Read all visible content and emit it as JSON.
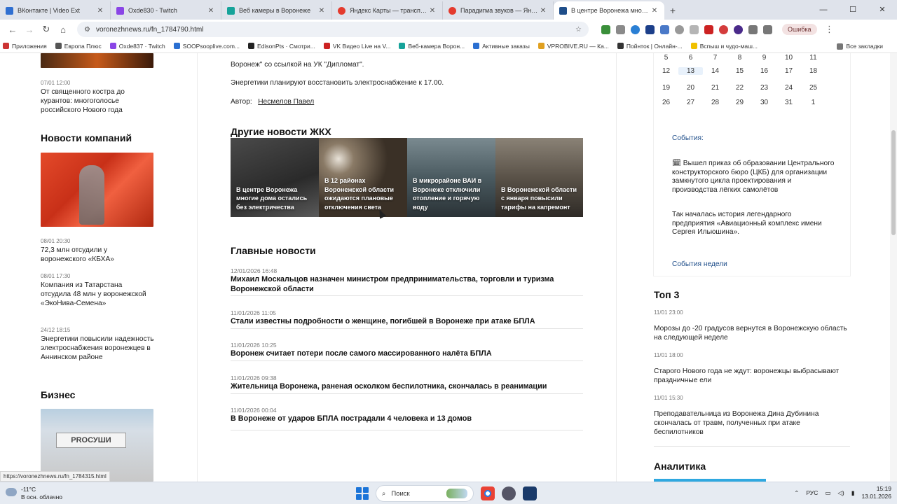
{
  "browser": {
    "tabs": [
      {
        "title": "ВКонтакте | Video Ext",
        "fav": "#2f6fd1"
      },
      {
        "title": "Oxde830 - Twitch",
        "fav": "#8a45e6"
      },
      {
        "title": "Веб камеры в Воронеже",
        "fav": "#16a39a"
      },
      {
        "title": "Яндекс Карты — транспорт, н",
        "fav": "#e43b2e"
      },
      {
        "title": "Парадигма звуков — Яндекс М",
        "fav": "#e43b2e"
      },
      {
        "title": "В центре Воронежа многие д",
        "fav": "#1f4e8a"
      }
    ],
    "new_tab": "+",
    "url": "voronezhnews.ru/fn_1784790.html",
    "error_label": "Ошибка",
    "bookmarks": [
      "Приложения",
      "Европа Плюс",
      "Oxde837 · Twitch",
      "SOOPsooplive.com...",
      "EdisonPts · Смотри...",
      "VK Видео Live на V...",
      "Веб-камера Ворон...",
      "Активные заказы",
      "VPROBIVE.RU — Ка...",
      "Пойнток | Онлайн-...",
      "Вспыш и чудо-маш..."
    ],
    "all_bookmarks": "Все закладки"
  },
  "left": {
    "item1": {
      "date": "07/01 12:00",
      "title": "От священного костра до курантов: многоголосье российского Нового года"
    },
    "companies_heading": "Новости компаний",
    "items": [
      {
        "date": "08/01 20:30",
        "title": "72,3 млн отсудили у воронежского «КБХА»"
      },
      {
        "date": "08/01 17:30",
        "title": "Компания из Татарстана отсудила 48 млн у воронежской «ЭкоНива-Семена»"
      },
      {
        "date": "24/12 18:15",
        "title": "Энергетики повысили надежность электроснабжения воронежцев в Аннинском районе"
      }
    ],
    "business_heading": "Бизнес",
    "business_sign": "PROСУШИ"
  },
  "center": {
    "para_tail": "Воронеж\" со ссылкой на УК \"Дипломат\".",
    "para2": "Энергетики планируют восстановить электроснабжение к 17.00.",
    "author_label": "Автор:",
    "author_name": "Несмелов Павел",
    "zhkh_heading": "Другие новости ЖКХ",
    "cards": [
      "В центре Воронежа многие дома остались без электричества",
      "В 12 районах Воронежской области ожидаются плановые отключения света",
      "В микрорайоне ВАИ в Воронеже отключили отопление и горячую воду",
      "В Воронежской области с января повысили тарифы на капремонт"
    ],
    "main_heading": "Главные новости",
    "main_news": [
      {
        "date": "12/01/2026 16:48",
        "title": "Михаил Москальцов назначен министром предпринимательства, торговли и туризма Воронежской области"
      },
      {
        "date": "11/01/2026 11:05",
        "title": "Стали известны подробности о женщине, погибшей в Воронеже при атаке БПЛА"
      },
      {
        "date": "11/01/2026 10:25",
        "title": "Воронеж считает потери после самого массированного налёта БПЛА"
      },
      {
        "date": "11/01/2026 09:38",
        "title": "Жительница Воронежа, раненая осколком беспилотника, скончалась в реанимации"
      },
      {
        "date": "11/01/2026 00:04",
        "title": "В Воронеже от ударов БПЛА пострадали 4 человека и 13 домов"
      }
    ]
  },
  "right": {
    "calendar": {
      "rows": [
        [
          "5",
          "6",
          "7",
          "8",
          "9",
          "10",
          "11"
        ],
        [
          "12",
          "13",
          "14",
          "15",
          "16",
          "17",
          "18"
        ],
        [
          "19",
          "20",
          "21",
          "22",
          "23",
          "24",
          "25"
        ],
        [
          "26",
          "27",
          "28",
          "29",
          "30",
          "31",
          "1"
        ]
      ],
      "today": "13"
    },
    "events_heading": "События:",
    "event1": "Вышел приказ об образовании Центрального конструкторского бюро (ЦКБ) для организации замкнутого цикла проектирования и производства лёгких самолётов",
    "event2": "Так началась история легендарного предприятия «Авиационный комплекс имени Сергея Ильюшина».",
    "events_link": "События недели",
    "top_heading": "Топ 3",
    "top": [
      {
        "date": "11/01 23:00",
        "title": "Морозы до -20 градусов вернутся в Воронежскую область на следующей неделе"
      },
      {
        "date": "11/01 18:00",
        "title": "Старого Нового года не ждут: воронежцы выбрасывают праздничные ели"
      },
      {
        "date": "11/01 15:30",
        "title": "Преподавательница из Воронежа Дина Дубинина скончалась от травм, полученных при атаке беспилотников"
      }
    ],
    "analytics_heading": "Аналитика"
  },
  "status_url": "https://voronezhnews.ru/fn_1784315.html",
  "taskbar": {
    "temp": "-11°C",
    "weather": "В осн. облачно",
    "search": "Поиск",
    "lang": "РУС",
    "time": "15:19",
    "date": "13.01.2026"
  }
}
